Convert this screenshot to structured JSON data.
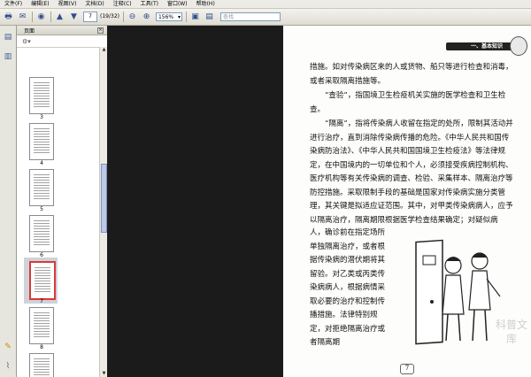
{
  "menu": [
    "文件(F)",
    "编辑(E)",
    "视图(V)",
    "文档(D)",
    "注释(C)",
    "工具(T)",
    "窗口(W)",
    "帮助(H)"
  ],
  "toolbar": {
    "page_current": "7",
    "page_count": "(19/32)",
    "zoom": "156%",
    "search_placeholder": "查找"
  },
  "thumb_panel": {
    "title": "页面",
    "labels": [
      "3",
      "4",
      "5",
      "6",
      "7",
      "8"
    ],
    "selected": "7"
  },
  "doc": {
    "header_title": "一、基本知识",
    "paragraphs": [
      "措施。如对传染病区来的人或货物、船只等进行检查和消毒，或者采取隔离措施等。",
      "“查验”，指国境卫生检疫机关实施的医学检查和卫生检查。",
      "“隔离”，指将传染病人收留在指定的处所，限制其活动并进行治疗，直到消除传染病传播的危险。《中华人民共和国传染病防治法》、《中华人民共和国国境卫生检疫法》等法律规定，在中国境内的一切单位和个人，必须接受疾病控制机构、医疗机构等有关传染病的调查、检验、采集样本、隔离治疗等防控措施。采取限制手段的基础是国家对传染病实施分类管理，其关键是拟适应证范围。其中，对甲类传染病病人，应予以隔离治疗，隔离期限根据医学检查结果确定；对疑似病"
    ],
    "narrow_lines": "人，确诊前在指定场所单独隔离治疗，或者根据传染病的潜伏期将其留验。对乙类或丙类传染病病人，根据病情采取必要的治疗和控制传播措施。法律特别规定，对拒绝隔离治疗或者隔离期",
    "watermark": "科普文库",
    "page_number": "7"
  }
}
